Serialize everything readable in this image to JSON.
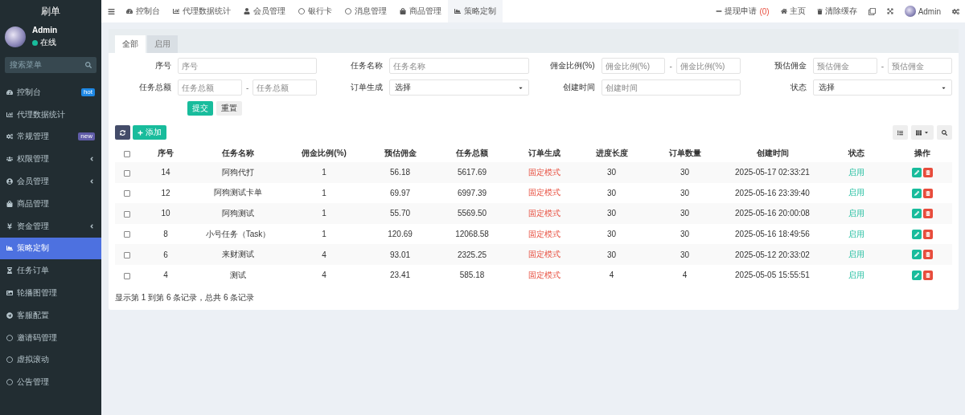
{
  "sidebar": {
    "logo": "刷单",
    "user": {
      "name": "Admin",
      "status": "在线",
      "online": true
    },
    "search": {
      "placeholder": "搜索菜单"
    },
    "items": [
      {
        "label": "控制台",
        "selected": false,
        "badge": {
          "text": "hot",
          "color": "#1e88e5"
        }
      },
      {
        "label": "代理数据统计",
        "selected": false
      },
      {
        "label": "常规管理",
        "selected": false,
        "badge": {
          "text": "new",
          "color": "#605ca8"
        }
      },
      {
        "label": "权限管理",
        "selected": false,
        "has_submenu": true
      },
      {
        "label": "会员管理",
        "selected": false,
        "has_submenu": true
      },
      {
        "label": "商品管理",
        "selected": false
      },
      {
        "label": "资金管理",
        "selected": false,
        "has_submenu": true
      },
      {
        "label": "策略定制",
        "selected": true
      },
      {
        "label": "任务订单",
        "selected": false
      },
      {
        "label": "轮播图管理",
        "selected": false
      },
      {
        "label": "客服配置",
        "selected": false
      },
      {
        "label": "邀请码管理",
        "selected": false
      },
      {
        "label": "虚拟滚动",
        "selected": false
      },
      {
        "label": "公告管理",
        "selected": false
      }
    ]
  },
  "top_tabs": [
    {
      "label": "控制台",
      "selected": false
    },
    {
      "label": "代理数据统计",
      "selected": false
    },
    {
      "label": "会员管理",
      "selected": false
    },
    {
      "label": "银行卡",
      "selected": false
    },
    {
      "label": "消息管理",
      "selected": false
    },
    {
      "label": "商品管理",
      "selected": false
    },
    {
      "label": "策略定制",
      "selected": true
    }
  ],
  "top_right": {
    "withdraw": {
      "label": "提现申请",
      "count": "(0)"
    },
    "home": "主页",
    "clear_cache": "清除缓存",
    "user": "Admin"
  },
  "panel_tabs": [
    {
      "label": "全部",
      "selected": true
    },
    {
      "label": "启用",
      "selected": false
    }
  ],
  "filters": [
    {
      "kind": "text",
      "label": "序号",
      "placeholder": "序号"
    },
    {
      "kind": "text",
      "label": "任务名称",
      "placeholder": "任务名称"
    },
    {
      "kind": "range",
      "label": "佣金比例(%)",
      "placeholder": "佣金比例(%)",
      "placeholder_to": "佣金比例(%)",
      "separator": "-"
    },
    {
      "kind": "range",
      "label": "预估佣金",
      "placeholder": "预估佣金",
      "placeholder_to": "预估佣金",
      "separator": "-"
    },
    {
      "kind": "range",
      "label": "任务总额",
      "placeholder": "任务总额",
      "placeholder_to": "任务总额",
      "separator": "-"
    },
    {
      "kind": "select",
      "label": "订单生成",
      "value": "选择"
    },
    {
      "kind": "text",
      "label": "创建时间",
      "placeholder": "创建时间"
    },
    {
      "kind": "select",
      "label": "状态",
      "value": "选择"
    }
  ],
  "form_buttons": [
    "提交",
    "重置"
  ],
  "toolbar": {
    "add": "添加"
  },
  "table": {
    "header_checked": false,
    "columns": [
      {
        "kind": "text",
        "label": "序号"
      },
      {
        "kind": "text",
        "label": "任务名称"
      },
      {
        "kind": "text",
        "label": "佣金比例(%)"
      },
      {
        "kind": "text",
        "label": "预估佣金"
      },
      {
        "kind": "text",
        "label": "任务总额"
      },
      {
        "kind": "mode",
        "label": "订单生成"
      },
      {
        "kind": "text",
        "label": "进度长度"
      },
      {
        "kind": "text",
        "label": "订单数量"
      },
      {
        "kind": "text",
        "label": "创建时间"
      },
      {
        "kind": "status",
        "label": "状态"
      },
      {
        "kind": "actions",
        "label": "操作"
      }
    ],
    "rows": [
      {
        "checked": false,
        "cells": [
          "14",
          "阿狗代打",
          "1",
          "56.18",
          "5617.69",
          "固定模式",
          "30",
          "30",
          "2025-05-17 02:33:21",
          "启用"
        ]
      },
      {
        "checked": false,
        "cells": [
          "12",
          "阿狗测试卡单",
          "1",
          "69.97",
          "6997.39",
          "固定模式",
          "30",
          "30",
          "2025-05-16 23:39:40",
          "启用"
        ]
      },
      {
        "checked": false,
        "cells": [
          "10",
          "阿狗测试",
          "1",
          "55.70",
          "5569.50",
          "固定模式",
          "30",
          "30",
          "2025-05-16 20:00:08",
          "启用"
        ]
      },
      {
        "checked": false,
        "cells": [
          "8",
          "小号任务（Task）",
          "1",
          "120.69",
          "12068.58",
          "固定模式",
          "30",
          "30",
          "2025-05-16 18:49:56",
          "启用"
        ]
      },
      {
        "checked": false,
        "cells": [
          "6",
          "来财测试",
          "4",
          "93.01",
          "2325.25",
          "固定模式",
          "30",
          "30",
          "2025-05-12 20:33:02",
          "启用"
        ]
      },
      {
        "checked": false,
        "cells": [
          "4",
          "测试",
          "4",
          "23.41",
          "585.18",
          "固定模式",
          "4",
          "4",
          "2025-05-05 15:55:51",
          "启用"
        ]
      }
    ]
  },
  "footer": "显示第 1 到第 6 条记录，总共 6 条记录"
}
